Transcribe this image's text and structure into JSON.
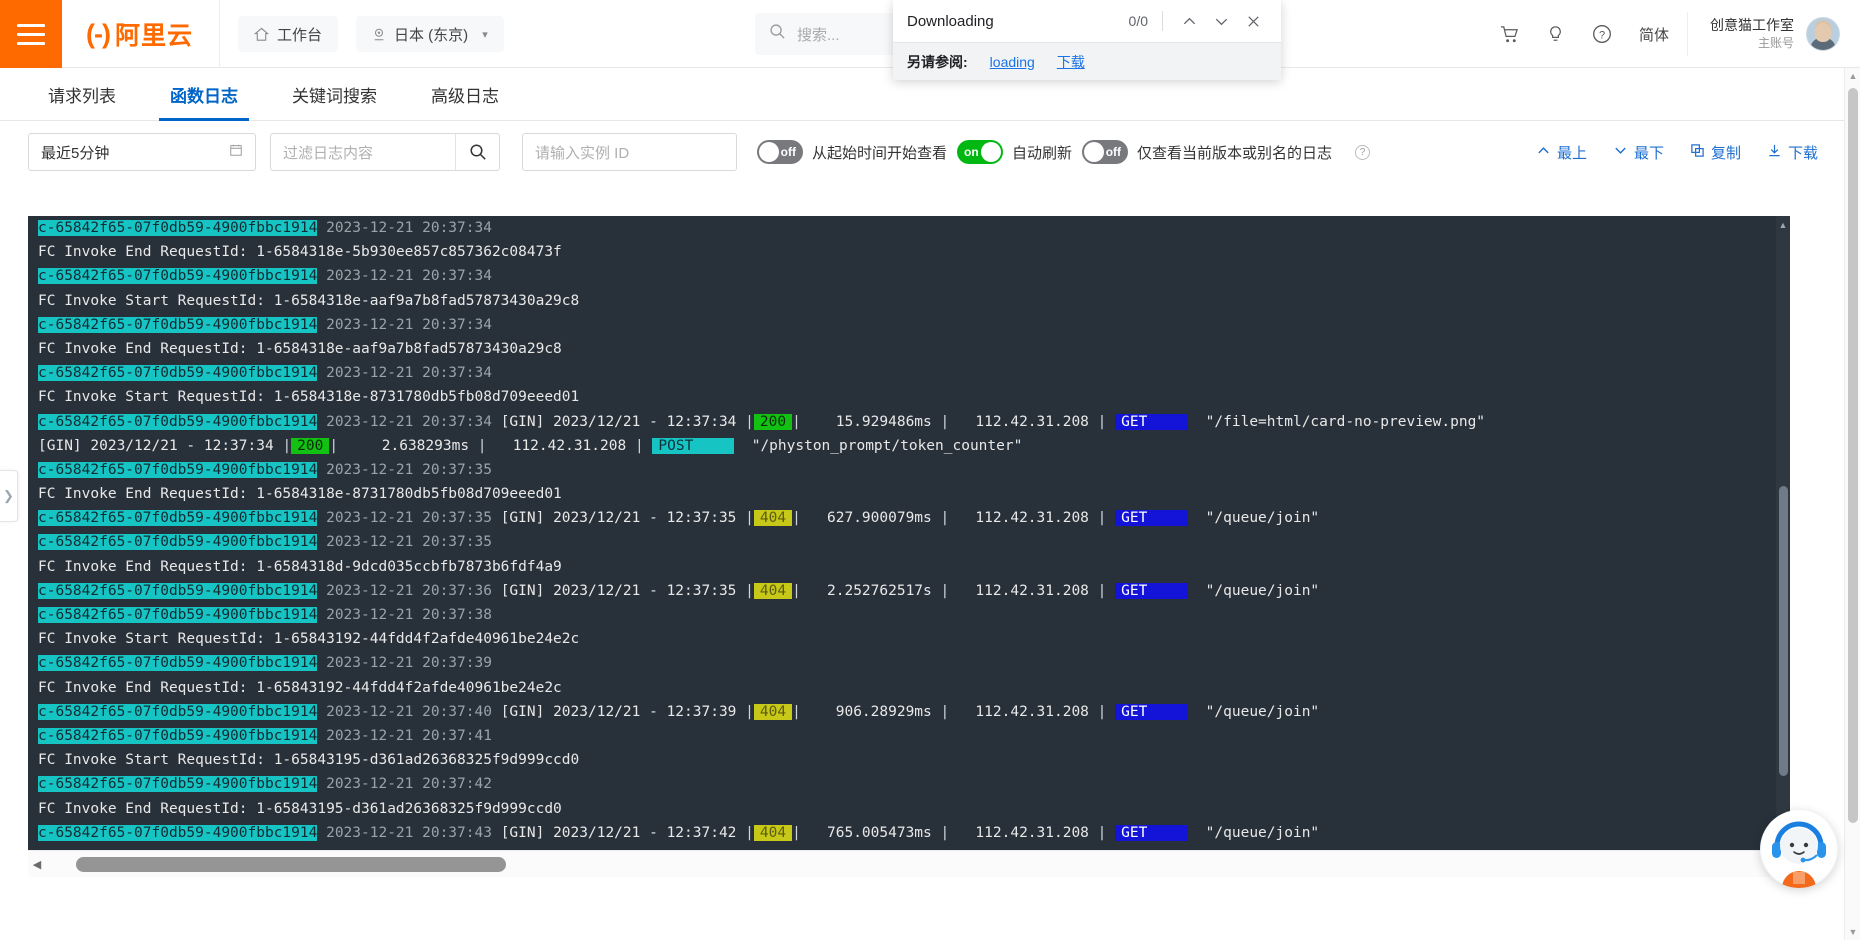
{
  "header": {
    "logo_mark": "(-)",
    "logo_text": "阿里云",
    "workbench": "工作台",
    "region": "日本 (东京)",
    "search_placeholder": "搜索...",
    "lang": "简体",
    "user_name": "创意猫工作室",
    "user_role": "主账号",
    "icons": {
      "menu": "hamburger-icon",
      "home": "home-icon",
      "location": "location-pin-icon",
      "search": "search-icon",
      "cart": "shopping-cart-icon",
      "bulb": "lightbulb-icon",
      "help": "question-circle-icon"
    }
  },
  "download_popup": {
    "title": "Downloading",
    "count": "0/0",
    "see_also_label": "另请参阅:",
    "links": [
      "loading",
      "下载"
    ],
    "buttons": {
      "up": "chevron-up-icon",
      "down": "chevron-down-icon",
      "close": "close-icon"
    }
  },
  "tabs": [
    {
      "label": "请求列表",
      "active": false
    },
    {
      "label": "函数日志",
      "active": true
    },
    {
      "label": "关键词搜索",
      "active": false
    },
    {
      "label": "高级日志",
      "active": false
    }
  ],
  "toolbar": {
    "time_range": "最近5分钟",
    "filter_placeholder": "过滤日志内容",
    "instance_placeholder": "请输入实例 ID",
    "toggles": [
      {
        "state": "off",
        "label": "从起始时间开始查看"
      },
      {
        "state": "on",
        "label": "自动刷新"
      },
      {
        "state": "off",
        "label": "仅查看当前版本或别名的日志",
        "help": true
      }
    ],
    "actions": [
      {
        "icon": "chevron-up-icon",
        "label": "最上"
      },
      {
        "icon": "chevron-down-icon",
        "label": "最下"
      },
      {
        "icon": "copy-icon",
        "label": "复制"
      },
      {
        "icon": "download-icon",
        "label": "下载"
      }
    ]
  },
  "log": {
    "instance_id": "c-65842f65-07f0db59-4900fbbc1914",
    "lines": [
      {
        "type": "meta",
        "id": "c-65842f65-07f0db59-4900fbbc1914",
        "ts": "2023-12-21 20:37:34"
      },
      {
        "type": "text",
        "text": "FC Invoke End RequestId: 1-6584318e-5b930ee857c857362c08473f"
      },
      {
        "type": "meta",
        "id": "c-65842f65-07f0db59-4900fbbc1914",
        "ts": "2023-12-21 20:37:34"
      },
      {
        "type": "text",
        "text": "FC Invoke Start RequestId: 1-6584318e-aaf9a7b8fad57873430a29c8"
      },
      {
        "type": "meta",
        "id": "c-65842f65-07f0db59-4900fbbc1914",
        "ts": "2023-12-21 20:37:34"
      },
      {
        "type": "text",
        "text": "FC Invoke End RequestId: 1-6584318e-aaf9a7b8fad57873430a29c8"
      },
      {
        "type": "meta",
        "id": "c-65842f65-07f0db59-4900fbbc1914",
        "ts": "2023-12-21 20:37:34"
      },
      {
        "type": "text",
        "text": "FC Invoke Start RequestId: 1-6584318e-8731780db5fb08d709eeed01"
      },
      {
        "type": "gin",
        "id": "c-65842f65-07f0db59-4900fbbc1914",
        "ts": "2023-12-21 20:37:34",
        "gin_time": "[GIN] 2023/12/21 - 12:37:34",
        "status": "200",
        "status_kind": "s200",
        "latency": "15.929486ms",
        "ip": "112.42.31.208",
        "method": "GET",
        "method_kind": "mget",
        "path": "\"/file=html/card-no-preview.png\""
      },
      {
        "type": "gin_only",
        "gin_time": "[GIN] 2023/12/21 - 12:37:34",
        "status": "200",
        "status_kind": "s200",
        "latency": "2.638293ms",
        "ip": "112.42.31.208",
        "method": "POST",
        "method_kind": "mpost",
        "path": "\"/physton_prompt/token_counter\""
      },
      {
        "type": "meta",
        "id": "c-65842f65-07f0db59-4900fbbc1914",
        "ts": "2023-12-21 20:37:35"
      },
      {
        "type": "text",
        "text": "FC Invoke End RequestId: 1-6584318e-8731780db5fb08d709eeed01"
      },
      {
        "type": "gin",
        "id": "c-65842f65-07f0db59-4900fbbc1914",
        "ts": "2023-12-21 20:37:35",
        "gin_time": "[GIN] 2023/12/21 - 12:37:35",
        "status": "404",
        "status_kind": "s404",
        "latency": "627.900079ms",
        "ip": "112.42.31.208",
        "method": "GET",
        "method_kind": "mget",
        "path": "\"/queue/join\""
      },
      {
        "type": "meta",
        "id": "c-65842f65-07f0db59-4900fbbc1914",
        "ts": "2023-12-21 20:37:35"
      },
      {
        "type": "text",
        "text": "FC Invoke End RequestId: 1-6584318d-9dcd035ccbfb7873b6fdf4a9"
      },
      {
        "type": "gin",
        "id": "c-65842f65-07f0db59-4900fbbc1914",
        "ts": "2023-12-21 20:37:36",
        "gin_time": "[GIN] 2023/12/21 - 12:37:35",
        "status": "404",
        "status_kind": "s404",
        "latency": "2.252762517s",
        "ip": "112.42.31.208",
        "method": "GET",
        "method_kind": "mget",
        "path": "\"/queue/join\""
      },
      {
        "type": "meta",
        "id": "c-65842f65-07f0db59-4900fbbc1914",
        "ts": "2023-12-21 20:37:38"
      },
      {
        "type": "text",
        "text": "FC Invoke Start RequestId: 1-65843192-44fdd4f2afde40961be24e2c"
      },
      {
        "type": "meta",
        "id": "c-65842f65-07f0db59-4900fbbc1914",
        "ts": "2023-12-21 20:37:39"
      },
      {
        "type": "text",
        "text": "FC Invoke End RequestId: 1-65843192-44fdd4f2afde40961be24e2c"
      },
      {
        "type": "gin",
        "id": "c-65842f65-07f0db59-4900fbbc1914",
        "ts": "2023-12-21 20:37:40",
        "gin_time": "[GIN] 2023/12/21 - 12:37:39",
        "status": "404",
        "status_kind": "s404",
        "latency": "906.28929ms",
        "ip": "112.42.31.208",
        "method": "GET",
        "method_kind": "mget",
        "path": "\"/queue/join\""
      },
      {
        "type": "meta",
        "id": "c-65842f65-07f0db59-4900fbbc1914",
        "ts": "2023-12-21 20:37:41"
      },
      {
        "type": "text",
        "text": "FC Invoke Start RequestId: 1-65843195-d361ad26368325f9d999ccd0"
      },
      {
        "type": "meta",
        "id": "c-65842f65-07f0db59-4900fbbc1914",
        "ts": "2023-12-21 20:37:42"
      },
      {
        "type": "text",
        "text": "FC Invoke End RequestId: 1-65843195-d361ad26368325f9d999ccd0"
      },
      {
        "type": "gin",
        "id": "c-65842f65-07f0db59-4900fbbc1914",
        "ts": "2023-12-21 20:37:43",
        "gin_time": "[GIN] 2023/12/21 - 12:37:42",
        "status": "404",
        "status_kind": "s404",
        "latency": "765.005473ms",
        "ip": "112.42.31.208",
        "method": "GET",
        "method_kind": "mget",
        "path": "\"/queue/join\""
      }
    ]
  },
  "colors": {
    "brand_orange": "#ff6a00",
    "tab_blue": "#0064c8",
    "link_blue": "#1f6fd0",
    "log_bg": "#283039",
    "instance_highlight": "#17c4c4",
    "status_200": "#13c113",
    "status_404": "#c8c818",
    "method_get": "#1414d8",
    "toggle_on": "#00b811"
  }
}
